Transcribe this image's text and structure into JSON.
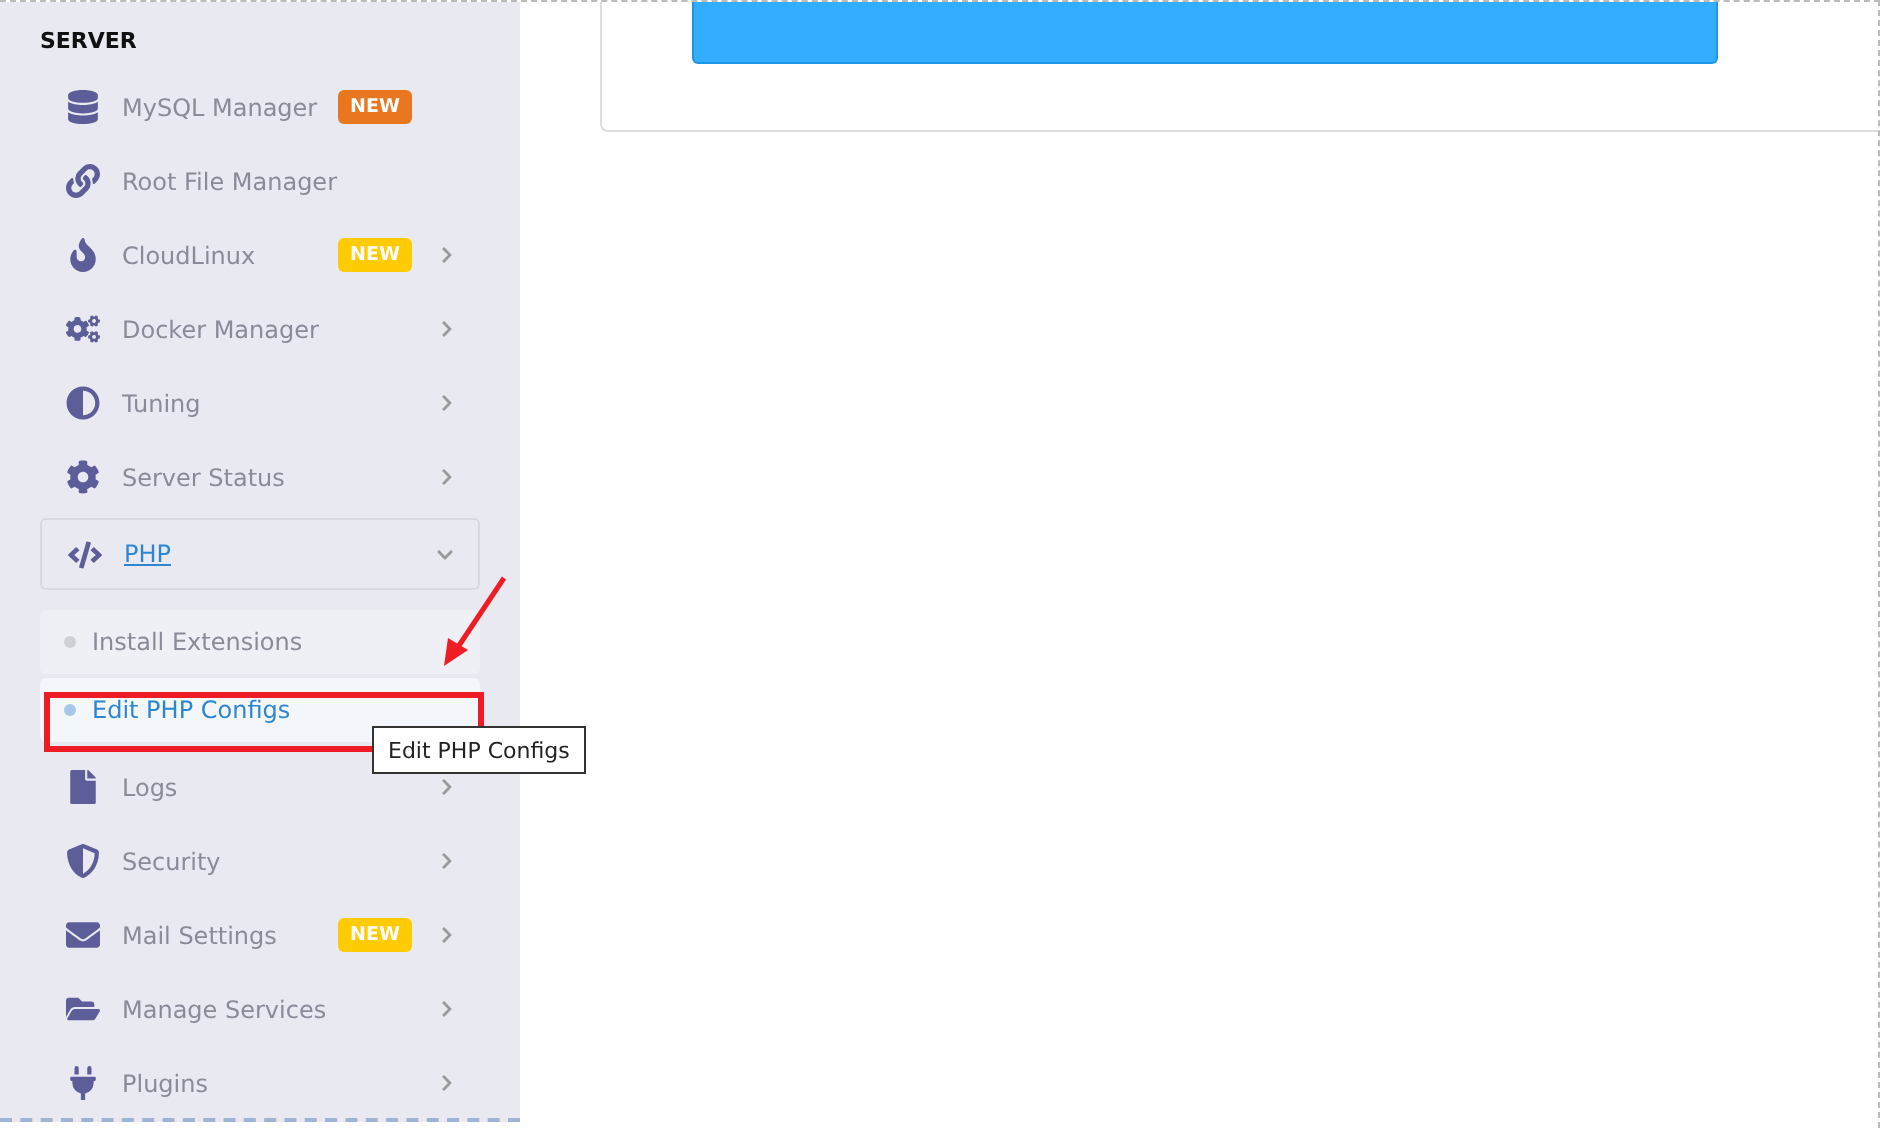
{
  "sidebar": {
    "heading": "SERVER",
    "items": [
      {
        "kind": "database",
        "label": "MySQL Manager",
        "badge": {
          "text": "NEW",
          "color": "#e8771f"
        },
        "has_submenu": false
      },
      {
        "kind": "link",
        "label": "Root File Manager",
        "has_submenu": false
      },
      {
        "kind": "fire",
        "label": "CloudLinux",
        "badge": {
          "text": "NEW",
          "color": "#fecb05"
        },
        "has_submenu": true
      },
      {
        "kind": "cogs",
        "label": "Docker Manager",
        "has_submenu": true
      },
      {
        "kind": "adjust",
        "label": "Tuning",
        "has_submenu": true
      },
      {
        "kind": "cog",
        "label": "Server Status",
        "has_submenu": true
      },
      {
        "kind": "code",
        "label": "PHP",
        "has_submenu": true,
        "expanded": true,
        "children": [
          {
            "label": "Install Extensions",
            "selected": false
          },
          {
            "label": "Edit PHP Configs",
            "selected": true
          }
        ]
      },
      {
        "kind": "file",
        "label": "Logs",
        "has_submenu": true
      },
      {
        "kind": "shield",
        "label": "Security",
        "has_submenu": true
      },
      {
        "kind": "envelope",
        "label": "Mail Settings",
        "badge": {
          "text": "NEW",
          "color": "#fecb05"
        },
        "has_submenu": true
      },
      {
        "kind": "folder",
        "label": "Manage Services",
        "has_submenu": true
      },
      {
        "kind": "plug",
        "label": "Plugins",
        "has_submenu": true
      }
    ]
  },
  "tooltip": "Edit PHP Configs"
}
